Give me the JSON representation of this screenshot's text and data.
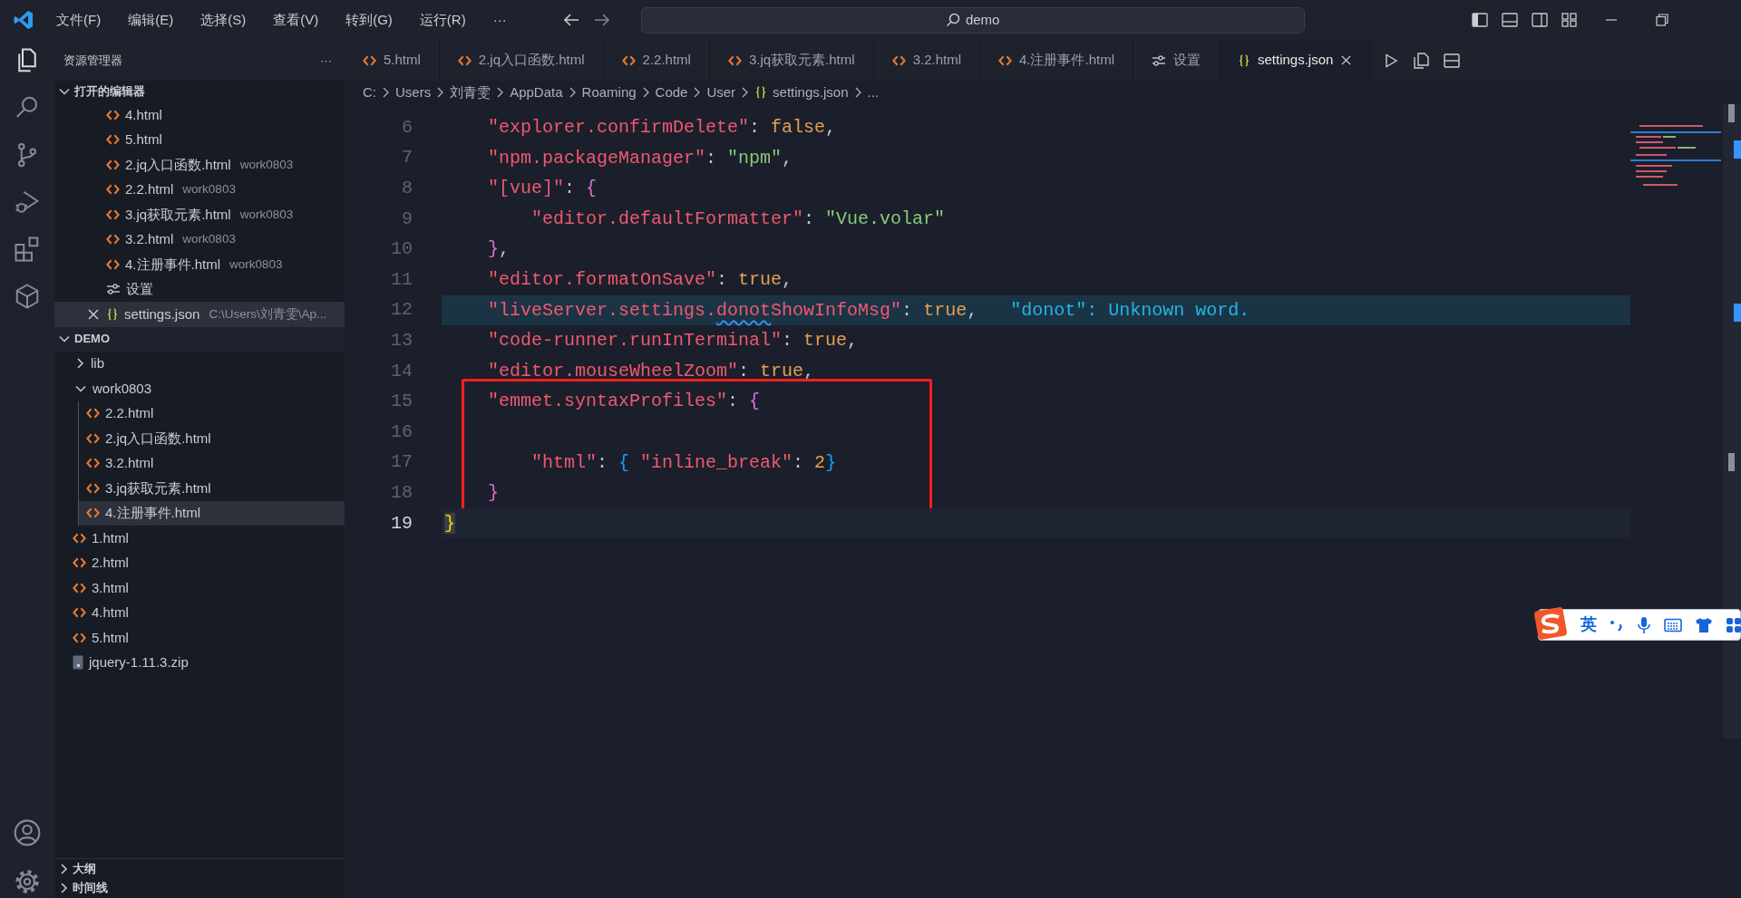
{
  "title_bar": {
    "menus": [
      "文件(F)",
      "编辑(E)",
      "选择(S)",
      "查看(V)",
      "转到(G)",
      "运行(R)"
    ],
    "more": "···",
    "search": {
      "value": "demo"
    }
  },
  "explorer": {
    "title": "资源管理器",
    "more": "···",
    "open_editors": {
      "title": "打开的编辑器",
      "expanded": true,
      "items": [
        {
          "name": "4.html",
          "kind": "html",
          "selected": false
        },
        {
          "name": "5.html",
          "kind": "html",
          "selected": false
        },
        {
          "name": "2.jq入口函数.html",
          "description": "work0803",
          "kind": "html",
          "selected": false
        },
        {
          "name": "2.2.html",
          "description": "work0803",
          "kind": "html",
          "selected": false
        },
        {
          "name": "3.jq获取元素.html",
          "description": "work0803",
          "kind": "html",
          "selected": false
        },
        {
          "name": "3.2.html",
          "description": "work0803",
          "kind": "html",
          "selected": false
        },
        {
          "name": "4.注册事件.html",
          "description": "work0803",
          "kind": "html",
          "selected": false
        },
        {
          "name": "设置",
          "kind": "settings",
          "selected": false
        },
        {
          "name": "settings.json",
          "description": "C:\\Users\\刘青雯\\Ap...",
          "kind": "json",
          "selected": true
        }
      ]
    },
    "folder": {
      "title": "DEMO",
      "expanded": true,
      "children": [
        {
          "name": "lib",
          "kind": "folder",
          "expanded": false,
          "selected": false
        },
        {
          "name": "work0803",
          "kind": "folder",
          "expanded": true,
          "selected": false,
          "children": [
            {
              "name": "2.2.html",
              "kind": "html",
              "selected": false
            },
            {
              "name": "2.jq入口函数.html",
              "kind": "html",
              "selected": false
            },
            {
              "name": "3.2.html",
              "kind": "html",
              "selected": false
            },
            {
              "name": "3.jq获取元素.html",
              "kind": "html",
              "selected": false
            },
            {
              "name": "4.注册事件.html",
              "kind": "html",
              "selected": true
            }
          ]
        },
        {
          "name": "1.html",
          "kind": "html",
          "selected": false
        },
        {
          "name": "2.html",
          "kind": "html",
          "selected": false
        },
        {
          "name": "3.html",
          "kind": "html",
          "selected": false
        },
        {
          "name": "4.html",
          "kind": "html",
          "selected": false
        },
        {
          "name": "5.html",
          "kind": "html",
          "selected": false
        },
        {
          "name": "jquery-1.11.3.zip",
          "kind": "zip",
          "selected": false
        }
      ]
    },
    "bottom_sections": [
      {
        "title": "大纲",
        "expanded": false
      },
      {
        "title": "时间线",
        "expanded": false
      }
    ]
  },
  "tabs": [
    {
      "label": "5.html",
      "kind": "html",
      "selected": false
    },
    {
      "label": "2.jq入口函数.html",
      "kind": "html",
      "selected": false
    },
    {
      "label": "2.2.html",
      "kind": "html",
      "selected": false
    },
    {
      "label": "3.jq获取元素.html",
      "kind": "html",
      "selected": false
    },
    {
      "label": "3.2.html",
      "kind": "html",
      "selected": false
    },
    {
      "label": "4.注册事件.html",
      "kind": "html",
      "selected": false
    },
    {
      "label": "设置",
      "kind": "settings",
      "selected": false
    },
    {
      "label": "settings.json",
      "kind": "json",
      "selected": true
    }
  ],
  "breadcrumb": [
    {
      "label": "C:",
      "kind": "folder"
    },
    {
      "label": "Users",
      "kind": "folder"
    },
    {
      "label": "刘青雯",
      "kind": "folder"
    },
    {
      "label": "AppData",
      "kind": "folder"
    },
    {
      "label": "Roaming",
      "kind": "folder"
    },
    {
      "label": "Code",
      "kind": "folder"
    },
    {
      "label": "User",
      "kind": "folder"
    },
    {
      "label": "settings.json",
      "kind": "json"
    },
    {
      "label": "...",
      "kind": "more"
    }
  ],
  "editor": {
    "lines": [
      {
        "number": "6",
        "highlighted": false,
        "current": false,
        "boxed": false,
        "tokens": [
          {
            "kind": "key",
            "s": "    \"explorer.confirmDelete\""
          },
          {
            "kind": "punct",
            "s": ": "
          },
          {
            "kind": "lit",
            "s": "false"
          },
          {
            "kind": "punct",
            "s": ","
          }
        ]
      },
      {
        "number": "7",
        "highlighted": false,
        "current": false,
        "boxed": false,
        "tokens": [
          {
            "kind": "key",
            "s": "    \"npm.packageManager\""
          },
          {
            "kind": "punct",
            "s": ": "
          },
          {
            "kind": "str",
            "s": "\"npm\""
          },
          {
            "kind": "punct",
            "s": ","
          }
        ]
      },
      {
        "number": "8",
        "highlighted": false,
        "current": false,
        "boxed": false,
        "tokens": [
          {
            "kind": "key",
            "s": "    \"[vue]\""
          },
          {
            "kind": "punct",
            "s": ": "
          },
          {
            "kind": "b2",
            "s": "{"
          }
        ]
      },
      {
        "number": "9",
        "highlighted": false,
        "current": false,
        "boxed": false,
        "tokens": [
          {
            "kind": "key",
            "s": "        \"editor.defaultFormatter\""
          },
          {
            "kind": "punct",
            "s": ": "
          },
          {
            "kind": "str",
            "s": "\"Vue.volar\""
          }
        ]
      },
      {
        "number": "10",
        "highlighted": false,
        "current": false,
        "boxed": false,
        "tokens": [
          {
            "kind": "b2",
            "s": "    }"
          },
          {
            "kind": "punct",
            "s": ","
          }
        ]
      },
      {
        "number": "11",
        "highlighted": false,
        "current": false,
        "boxed": false,
        "tokens": [
          {
            "kind": "key",
            "s": "    \"editor.formatOnSave\""
          },
          {
            "kind": "punct",
            "s": ": "
          },
          {
            "kind": "lit",
            "s": "true"
          },
          {
            "kind": "punct",
            "s": ","
          }
        ]
      },
      {
        "number": "12",
        "highlighted": true,
        "current": false,
        "boxed": false,
        "tokens": [
          {
            "kind": "key",
            "s": "    \"liveServer.settings.",
            "squiggle": false
          },
          {
            "kind": "key",
            "s": "donot",
            "squiggle": true
          },
          {
            "kind": "key",
            "s": "ShowInfoMsg\"",
            "squiggle": false
          },
          {
            "kind": "punct",
            "s": ": "
          },
          {
            "kind": "lit",
            "s": "true"
          },
          {
            "kind": "punct",
            "s": ","
          }
        ],
        "hint": "\"donot\": Unknown word."
      },
      {
        "number": "13",
        "highlighted": false,
        "current": false,
        "boxed": false,
        "tokens": [
          {
            "kind": "key",
            "s": "    \"code-runner.runInTerminal\""
          },
          {
            "kind": "punct",
            "s": ": "
          },
          {
            "kind": "lit",
            "s": "true"
          },
          {
            "kind": "punct",
            "s": ","
          }
        ]
      },
      {
        "number": "14",
        "highlighted": false,
        "current": false,
        "boxed": false,
        "tokens": [
          {
            "kind": "key",
            "s": "    \"editor.mouseWheelZoom\""
          },
          {
            "kind": "punct",
            "s": ": "
          },
          {
            "kind": "lit",
            "s": "true"
          },
          {
            "kind": "punct",
            "s": ","
          }
        ]
      },
      {
        "number": "15",
        "highlighted": false,
        "current": false,
        "boxed": true,
        "tokens": [
          {
            "kind": "key",
            "s": "    \"emmet.syntaxProfiles\""
          },
          {
            "kind": "punct",
            "s": ": "
          },
          {
            "kind": "b2",
            "s": "{"
          }
        ]
      },
      {
        "number": "16",
        "highlighted": false,
        "current": false,
        "boxed": true
      },
      {
        "number": "17",
        "highlighted": false,
        "current": false,
        "boxed": true,
        "tokens": [
          {
            "kind": "key",
            "s": "        \"html\""
          },
          {
            "kind": "punct",
            "s": ": "
          },
          {
            "kind": "b3",
            "s": "{"
          },
          {
            "kind": "key",
            "s": " \"inline_break\""
          },
          {
            "kind": "punct",
            "s": ": "
          },
          {
            "kind": "lit",
            "s": "2"
          },
          {
            "kind": "b3",
            "s": "}"
          }
        ]
      },
      {
        "number": "18",
        "highlighted": false,
        "current": false,
        "boxed": true,
        "tokens": [
          {
            "kind": "b2",
            "s": "    }"
          }
        ]
      },
      {
        "number": "19",
        "highlighted": false,
        "current": true,
        "boxed": false,
        "tokens": [
          {
            "kind": "b1",
            "s": "}"
          }
        ]
      }
    ]
  },
  "ime_toolbar": {
    "mode": "英"
  }
}
